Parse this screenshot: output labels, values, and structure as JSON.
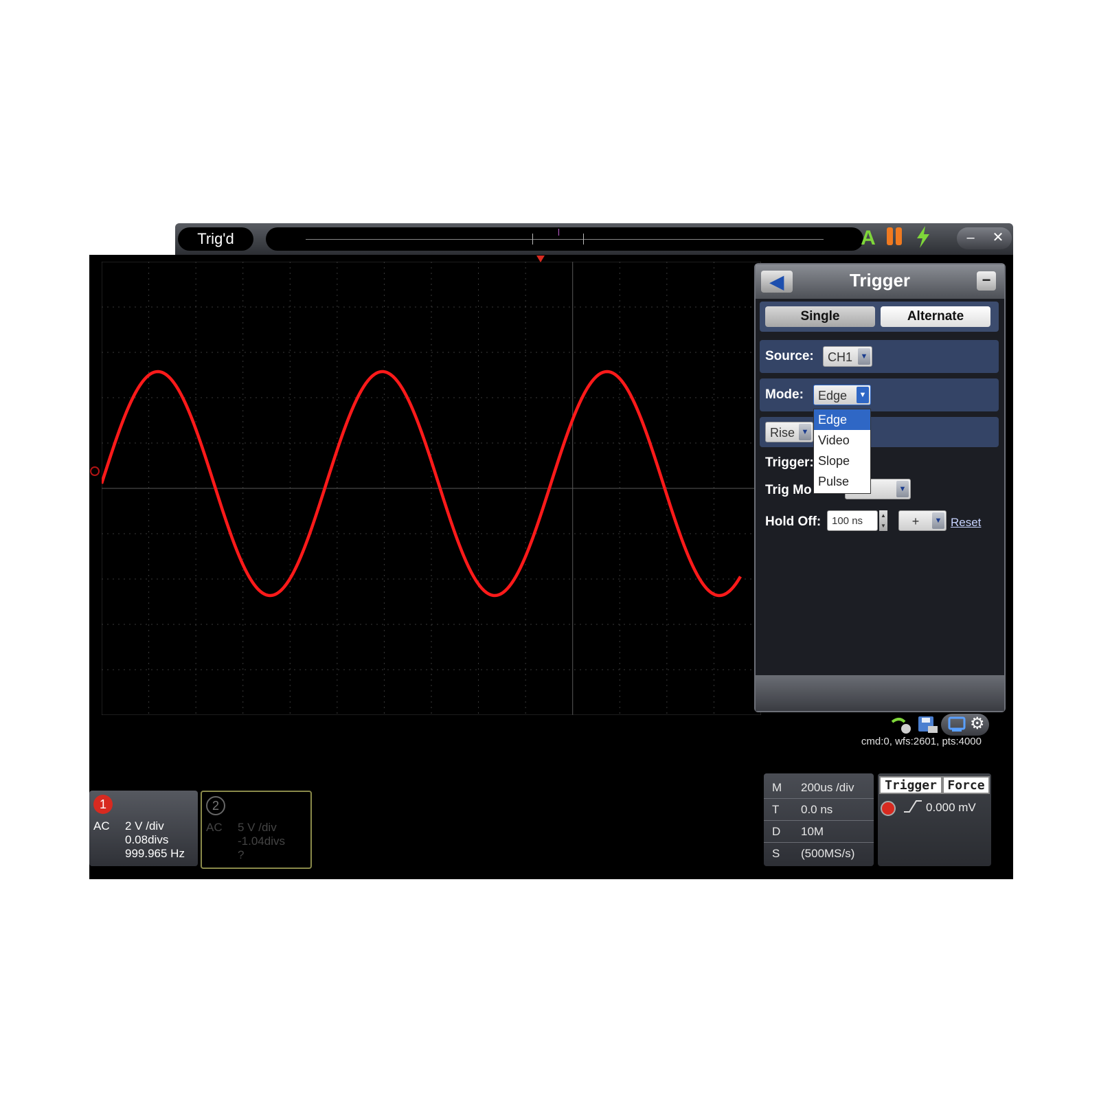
{
  "topbar": {
    "status": "Trig'd",
    "auto_icon": "A",
    "pause_icon": "pause-icon",
    "bolt_icon": "lightning-icon",
    "minimize": "–",
    "close": "✕"
  },
  "trigger_panel": {
    "title": "Trigger",
    "back_icon": "back-arrow-icon",
    "minimize": "−",
    "tabs": [
      "Single",
      "Alternate"
    ],
    "source_label": "Source:",
    "source_value": "CH1",
    "mode_label": "Mode:",
    "mode_value": "Edge",
    "mode_options": [
      "Edge",
      "Video",
      "Slope",
      "Pulse"
    ],
    "slope_value": "Rise",
    "trigger_label": "Trigger:",
    "trig_mode_label": "Trig Mo",
    "holdoff_label": "Hold Off:",
    "holdoff_value": "100 ns",
    "holdoff_step": "+",
    "reset": "Reset"
  },
  "status_line": "cmd:0, wfs:2601, pts:4000",
  "channels": [
    {
      "num": "1",
      "coupling": "AC",
      "volts": "2 V /div",
      "offset": "0.08divs",
      "freq": "999.965 Hz"
    },
    {
      "num": "2",
      "coupling": "AC",
      "volts": "5 V /div",
      "offset": "-1.04divs",
      "freq": "?"
    }
  ],
  "timebase": {
    "rows": [
      {
        "k": "M",
        "v": "200us /div"
      },
      {
        "k": "T",
        "v": "0.0 ns"
      },
      {
        "k": "D",
        "v": "10M"
      },
      {
        "k": "S",
        "v": "(500MS/s)"
      }
    ]
  },
  "trigger_box": {
    "trigger_btn": "Trigger",
    "force_btn": "Force",
    "level": "0.000 mV"
  },
  "colors": {
    "trace": "#ff1a1a",
    "panel_row": "#344466",
    "highlight": "#2f67c5"
  }
}
